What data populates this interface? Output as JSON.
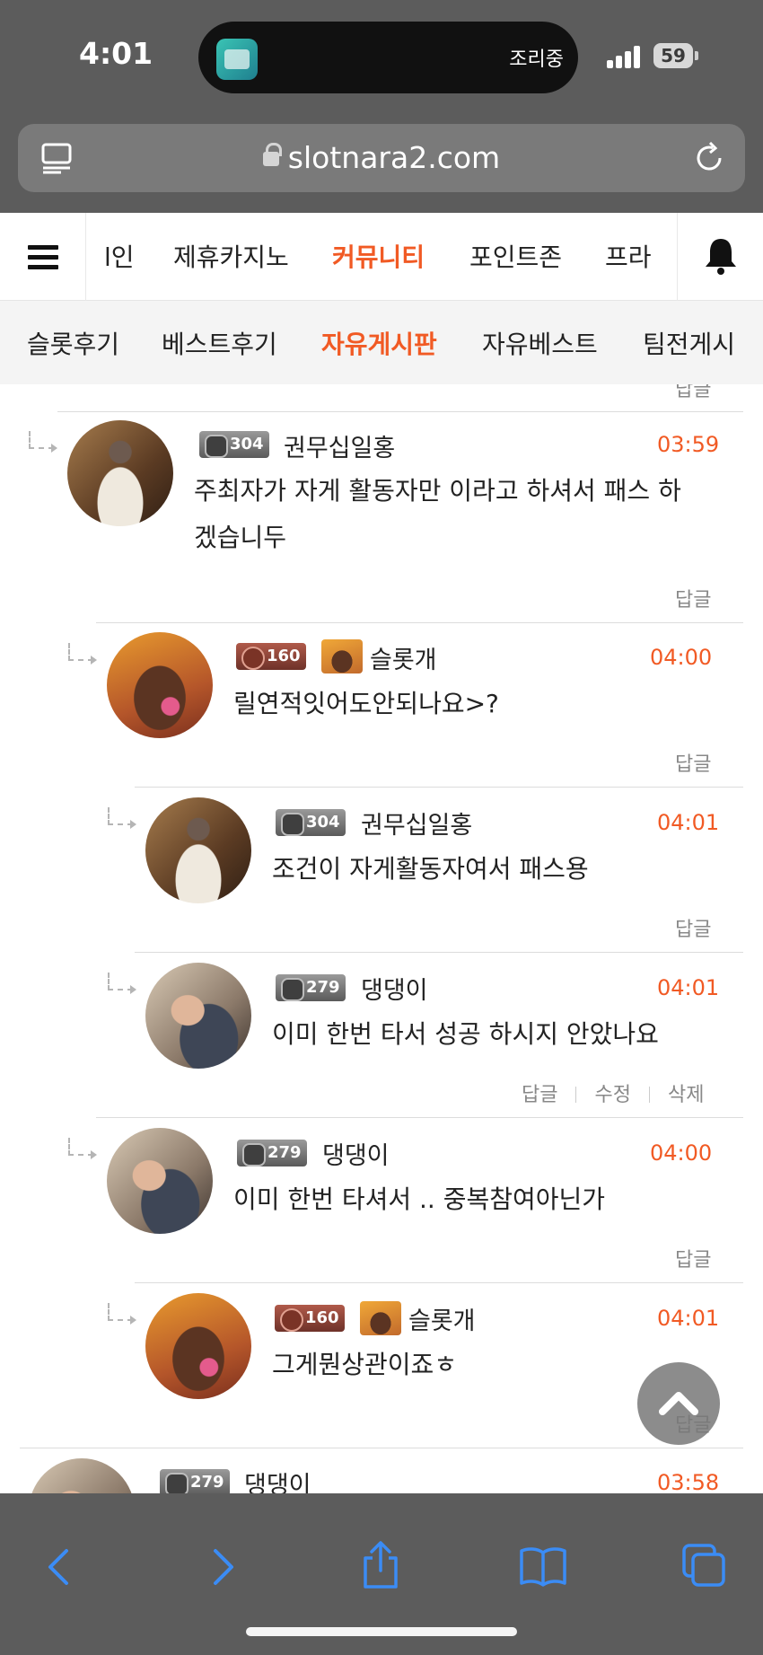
{
  "status_bar": {
    "time": "4:01",
    "island_text": "조리중",
    "battery": "59"
  },
  "url_bar": {
    "url": "slotnara2.com"
  },
  "nav": {
    "items": [
      "l인",
      "제휴카지노",
      "커뮤니티",
      "포인트존",
      "프라"
    ],
    "active": "커뮤니티"
  },
  "sub_nav": {
    "items": [
      "슬롯후기",
      "베스트후기",
      "자유게시판",
      "자유베스트",
      "팀전게시"
    ],
    "active": "자유게시판"
  },
  "partial_top_action": "답글",
  "comments": [
    {
      "level": "304",
      "nick": "권무십일홍",
      "time": "03:59",
      "text_line1": "주최자가 자게 활동자만 이라고 하셔서 패스 하",
      "text_line2": "겠습니두",
      "action": "답글"
    },
    {
      "level": "160",
      "nick": "슬롯개",
      "time": "04:00",
      "text": "릴연적잇어도안되나요>?",
      "action": "답글"
    },
    {
      "level": "304",
      "nick": "권무십일홍",
      "time": "04:01",
      "text": "조건이 자게활동자여서 패스용",
      "action": "답글"
    },
    {
      "level": "279",
      "nick": "댕댕이",
      "time": "04:01",
      "text": "이미 한번 타서 성공 하시지 안았나요",
      "actions": [
        "답글",
        "수정",
        "삭제"
      ]
    },
    {
      "level": "279",
      "nick": "댕댕이",
      "time": "04:00",
      "text": "이미 한번 타셔서 .. 중복참여아닌가",
      "action": "답글"
    },
    {
      "level": "160",
      "nick": "슬롯개",
      "time": "04:01",
      "text": "그게뭔상관이죠ㅎ",
      "action": "답글"
    },
    {
      "level": "279",
      "nick": "댕댕이",
      "time": "03:58"
    }
  ],
  "colors": {
    "accent": "#f15a24",
    "chrome": "#5c5c5c",
    "toolbar_icons": "#3b8cf5"
  },
  "icons": [
    "tabs-icon",
    "lock-icon",
    "reload-icon",
    "menu-icon",
    "bell-icon",
    "reply-arrow-icon",
    "chevron-up-icon",
    "back-icon",
    "forward-icon",
    "share-icon",
    "bookmarks-icon",
    "tabs-overview-icon"
  ]
}
